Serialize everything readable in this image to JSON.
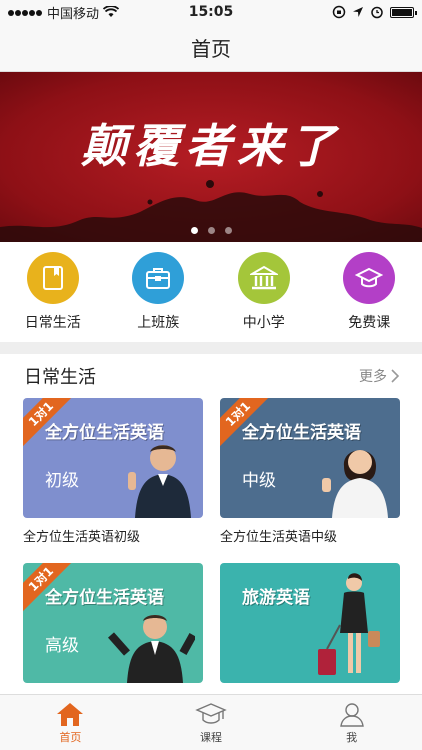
{
  "status_bar": {
    "carrier": "中国移动",
    "time": "15:05"
  },
  "nav": {
    "title": "首页"
  },
  "banner": {
    "headline": "颠覆者来了",
    "page_count": 3,
    "active_page": 1
  },
  "categories": [
    {
      "label": "日常生活",
      "icon": "notebook-icon",
      "color": "#e8b21c"
    },
    {
      "label": "上班族",
      "icon": "briefcase-icon",
      "color": "#2f9fd8"
    },
    {
      "label": "中小学",
      "icon": "school-building-icon",
      "color": "#a4c63a"
    },
    {
      "label": "免费课",
      "icon": "graduation-cap-icon",
      "color": "#b33fc7"
    }
  ],
  "section": {
    "title": "日常生活",
    "more_label": "更多"
  },
  "courses": [
    {
      "badge": "1对1",
      "title": "全方位生活英语",
      "level": "初级",
      "caption": "全方位生活英语初级",
      "color": "#7f8fce"
    },
    {
      "badge": "1对1",
      "title": "全方位生活英语",
      "level": "中级",
      "caption": "全方位生活英语中级",
      "color": "#4d6d8e"
    },
    {
      "badge": "1对1",
      "title": "全方位生活英语",
      "level": "高级",
      "caption": "",
      "color": "#4fb9a6"
    },
    {
      "badge": "",
      "title": "旅游英语",
      "level": "",
      "caption": "",
      "color": "#3bb3ad"
    }
  ],
  "tabs": [
    {
      "label": "首页",
      "icon": "home-icon",
      "active": true
    },
    {
      "label": "课程",
      "icon": "graduation-cap-icon",
      "active": false
    },
    {
      "label": "我",
      "icon": "person-icon",
      "active": false
    }
  ],
  "colors": {
    "accent": "#e2661f"
  }
}
